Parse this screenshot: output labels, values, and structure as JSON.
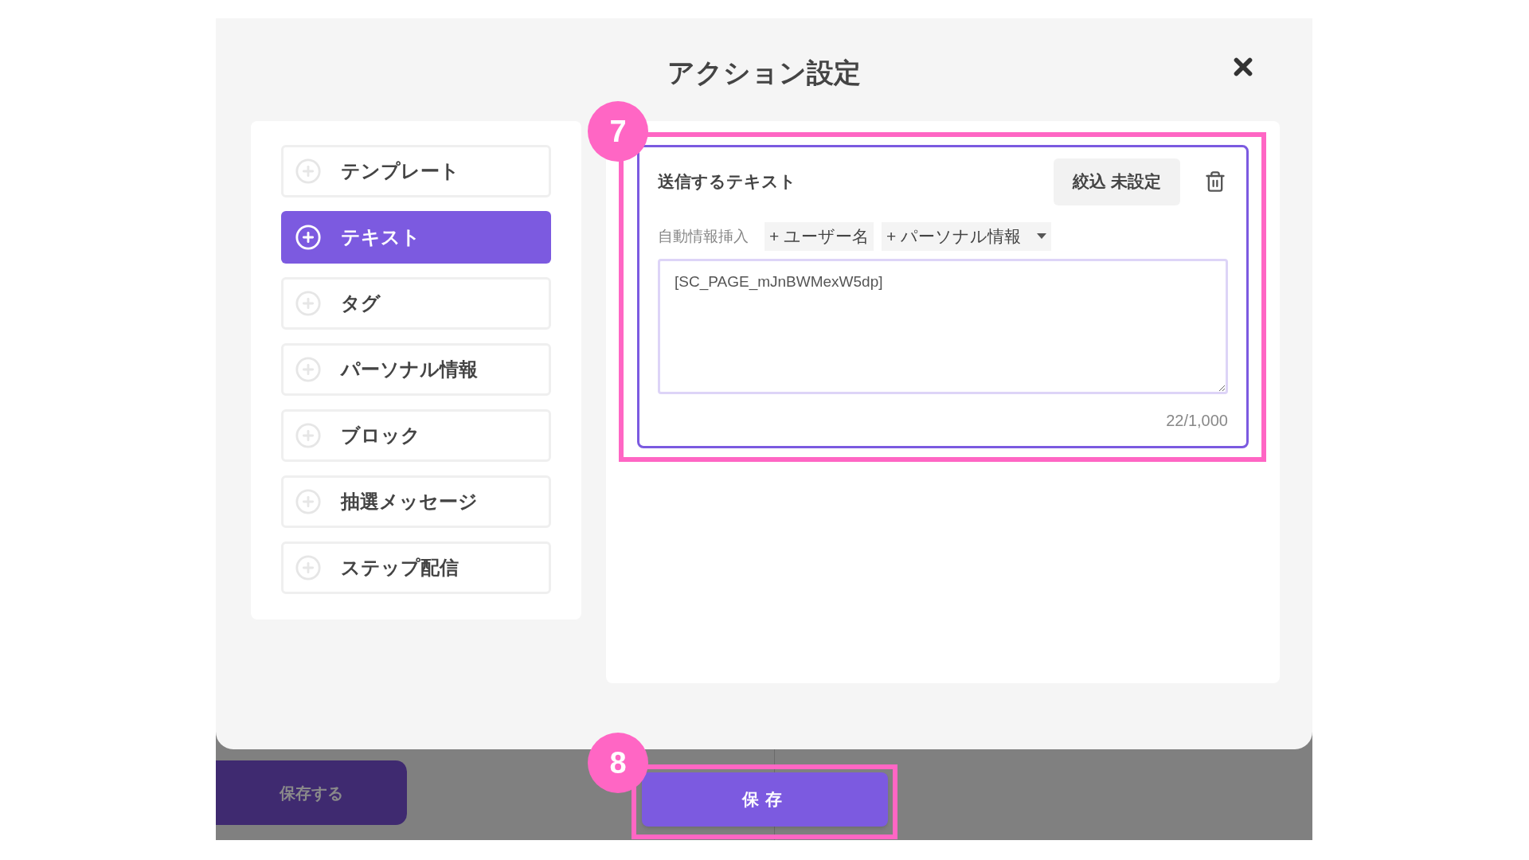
{
  "dialog": {
    "title": "アクション設定"
  },
  "action_types": [
    {
      "label": "テンプレート",
      "selected": false
    },
    {
      "label": "テキスト",
      "selected": true
    },
    {
      "label": "タグ",
      "selected": false
    },
    {
      "label": "パーソナル情報",
      "selected": false
    },
    {
      "label": "ブロック",
      "selected": false
    },
    {
      "label": "抽選メッセージ",
      "selected": false
    },
    {
      "label": "ステップ配信",
      "selected": false
    }
  ],
  "message_card": {
    "title": "送信するテキスト",
    "filter_button": "絞込 未設定",
    "auto_insert_label": "自動情報挿入",
    "insert_buttons": [
      {
        "label": "+ ユーザー名",
        "kind": "button"
      },
      {
        "label": "+ パーソナル情報",
        "kind": "dropdown"
      }
    ],
    "text_value": "[SC_PAGE_mJnBWMexW5dp]",
    "char_count": "22/1,000"
  },
  "background_button": "保存する",
  "save_button": "保存",
  "annotations": [
    {
      "label": "7"
    },
    {
      "label": "8"
    }
  ]
}
